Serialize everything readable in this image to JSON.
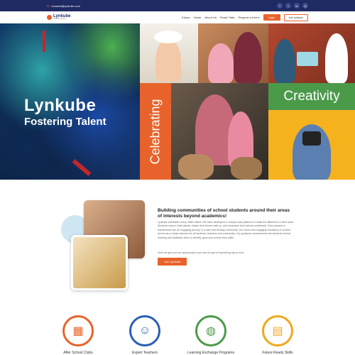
{
  "topbar": {
    "email": "connect@lynkube.com",
    "socials": [
      "facebook-icon",
      "twitter-icon",
      "linkedin-icon",
      "instagram-icon"
    ]
  },
  "nav": {
    "brand": "Lynkube",
    "tagline": "Fostering Talent",
    "items": [
      "Kuban",
      "Home",
      "About Us",
      "Smart Talks",
      "Request a Demo"
    ],
    "login": "Login",
    "join": "Join Lynkube"
  },
  "hero": {
    "title": "Lynkube",
    "subtitle": "Fostering Talent",
    "celebrating": "Celebrating",
    "creativity": "Creativity"
  },
  "about": {
    "heading": "Building communities of school students around their areas of interests beyond academics!",
    "body1": "Lynkube celebrates every child's talent. We have developed a campus-safe platform to make the difference in their lives! Students nurture their talents, shape their futures with us, and showcase their talents confidently. Their passion is transformed into an engaging journey, in a safe and thriving community. Our vision and engaging repository of content serves as a ready-reckoner for all students, teachers and community. Our guidance complements the students' formal learning and facilitates them to identify, grow and nurture their skills.",
    "body2": "Here we give you an opportunity to join and be part of something big of ours!",
    "cta": "Join Lynkube"
  },
  "features": [
    {
      "label": "After School Clubs",
      "icon": "blocks-icon",
      "color": "#e8632b"
    },
    {
      "label": "Expert Teachers",
      "icon": "teacher-icon",
      "color": "#2a5fb5"
    },
    {
      "label": "Learning Exchange Programs",
      "icon": "globe-icon",
      "color": "#4b9a4a"
    },
    {
      "label": "Future Ready Skills",
      "icon": "certificate-icon",
      "color": "#f0a81c"
    }
  ]
}
